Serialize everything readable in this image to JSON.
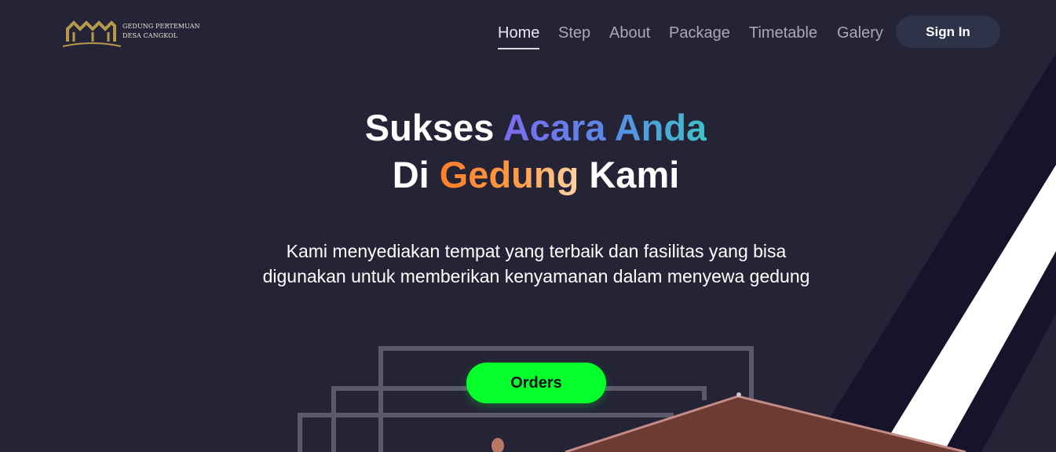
{
  "brand": {
    "line1": "GEDUNG PERTEMUAN",
    "line2": "DESA CANGKOL",
    "logo_color": "#b59a4c"
  },
  "nav": {
    "items": [
      {
        "label": "Home",
        "active": true
      },
      {
        "label": "Step",
        "active": false
      },
      {
        "label": "About",
        "active": false
      },
      {
        "label": "Package",
        "active": false
      },
      {
        "label": "Timetable",
        "active": false
      },
      {
        "label": "Galery",
        "active": false
      }
    ],
    "signin_label": "Sign In"
  },
  "hero": {
    "line1_word1": "Sukses",
    "line1_word2": "Acara Anda",
    "line2_word1": "Di",
    "line2_word2": "Gedung",
    "line2_word3": "Kami",
    "subtitle": "Kami menyediakan tempat yang terbaik dan fasilitas yang bisa digunakan untuk memberikan kenyamanan dalam menyewa gedung",
    "cta_label": "Orders"
  },
  "colors": {
    "background": "#252437",
    "accent_green": "#04ff2a",
    "gradient_blue": [
      "#7c6cf0",
      "#3fc1c9"
    ],
    "gradient_orange": [
      "#ff7f2a",
      "#ffd4a6"
    ],
    "roof": "#6b3b34"
  }
}
